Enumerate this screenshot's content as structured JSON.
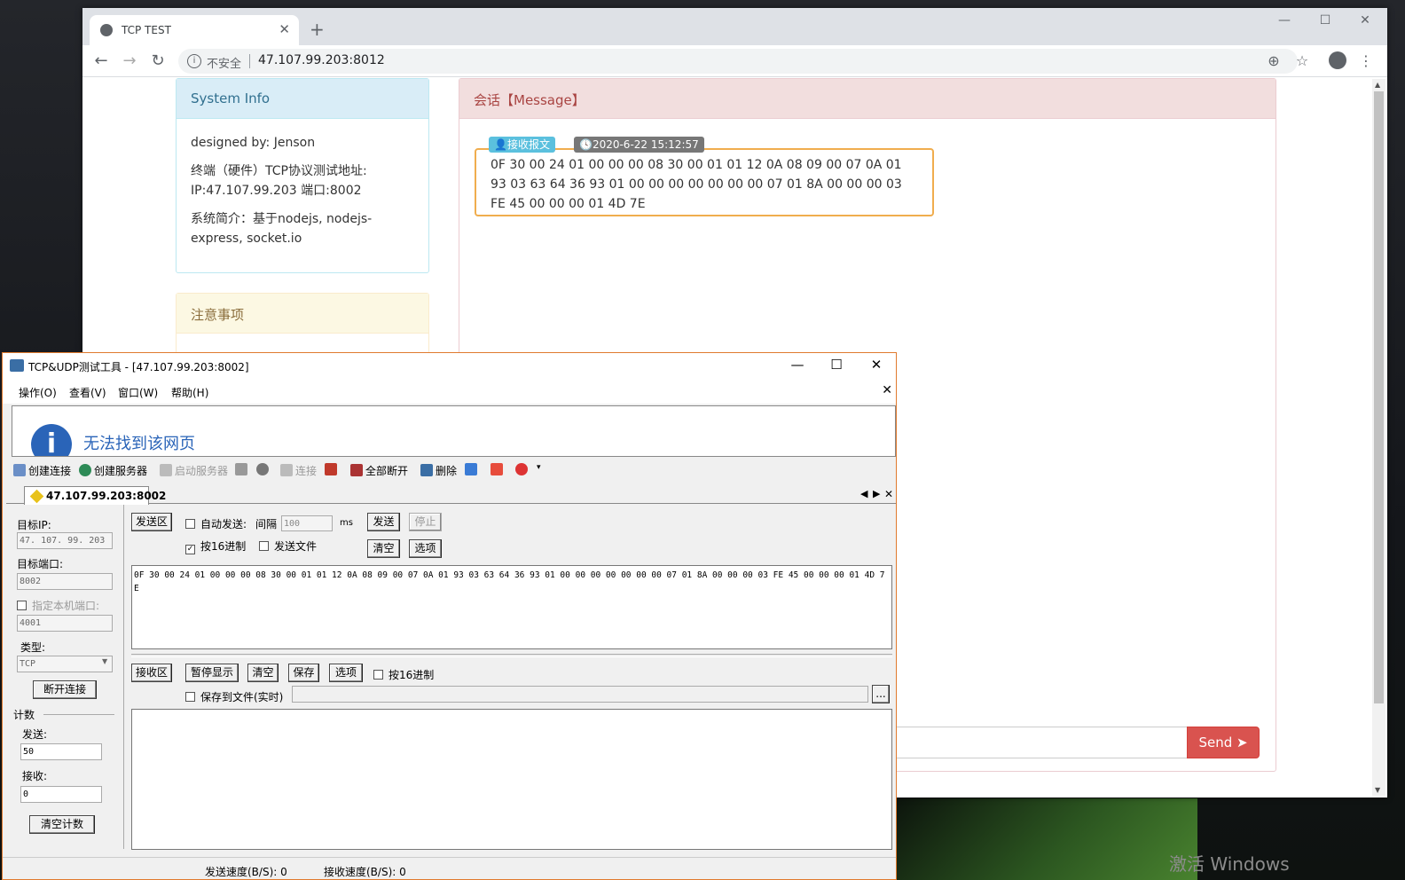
{
  "desktop": {
    "watermark": "激活 Windows"
  },
  "browser": {
    "tab_title": "TCP TEST",
    "tab_close": "✕",
    "new_tab": "+",
    "insecure_label": "不安全",
    "url": "47.107.99.203:8012",
    "window_controls": [
      "—",
      "☐",
      "✕"
    ]
  },
  "page": {
    "system_info": {
      "heading": "System Info",
      "designer": "designed by: Jenson",
      "address_label": "终端（硬件）TCP协议测试地址:",
      "address_value": "IP:47.107.99.203 端口:8002",
      "intro": "系统简介：基于nodejs, nodejs-express, socket.io"
    },
    "notice": {
      "heading": "注意事项"
    },
    "message": {
      "heading": "会话【Message】",
      "recv_label": "👤接收报文",
      "time_label": "🕓2020-6-22 15:12:57",
      "body": "0F 30 00 24 01 00 00 00 08 30 00 01 01 12 0A 08 09 00 07 0A 01 93 03 63 64 36 93 01 00 00 00 00 00 00 00 07 01 8A 00 00 00 03 FE 45 00 00 00 01 4D 7E"
    },
    "send_button": "Send ➤"
  },
  "tool": {
    "title": "TCP&UDP测试工具 - [47.107.99.203:8002]",
    "menu": [
      "操作(O)",
      "查看(V)",
      "窗口(W)",
      "帮助(H)"
    ],
    "embedded_notfound": "无法找到该网页",
    "toolbar": {
      "create_conn": "创建连接",
      "create_server": "创建服务器",
      "start_server": "启动服务器",
      "connect": "连接",
      "disconnect_all": "全部断开",
      "delete": "删除"
    },
    "conn_tab": "47.107.99.203:8002",
    "left": {
      "target_ip_label": "目标IP:",
      "target_ip": "47. 107. 99. 203",
      "target_port_label": "目标端口:",
      "target_port": "8002",
      "local_port_label": "指定本机端口:",
      "local_port": "4001",
      "type_label": "类型:",
      "type_value": "TCP",
      "disconnect": "断开连接",
      "count_label": "计数",
      "send_label": "发送:",
      "send_count": "50",
      "recv_label": "接收:",
      "recv_count": "0",
      "clear_count": "清空计数"
    },
    "send": {
      "area_label": "发送区",
      "auto_send": "自动发送:",
      "interval_label": "间隔",
      "interval_value": "100",
      "interval_unit": "ms",
      "send_btn": "发送",
      "stop_btn": "停止",
      "hex": "按16进制",
      "send_file": "发送文件",
      "clear_btn": "清空",
      "options_btn": "选项",
      "content": "0F 30 00 24 01 00 00 00 08 30 00 01 01 12 0A 08 09 00 07 0A 01 93 03 63 64 36 93 01 00 00 00 00 00 00 00 07  01 8A 00 00 00 03 FE 45 00 00 00 01 4D 7E"
    },
    "recv": {
      "area_label": "接收区",
      "pause_btn": "暂停显示",
      "clear_btn": "清空",
      "save_btn": "保存",
      "options_btn": "选项",
      "hex": "按16进制",
      "save_to_file": "保存到文件(实时)",
      "browse": "..."
    },
    "status": {
      "send_speed": "发送速度(B/S): 0",
      "recv_speed": "接收速度(B/S): 0"
    }
  }
}
